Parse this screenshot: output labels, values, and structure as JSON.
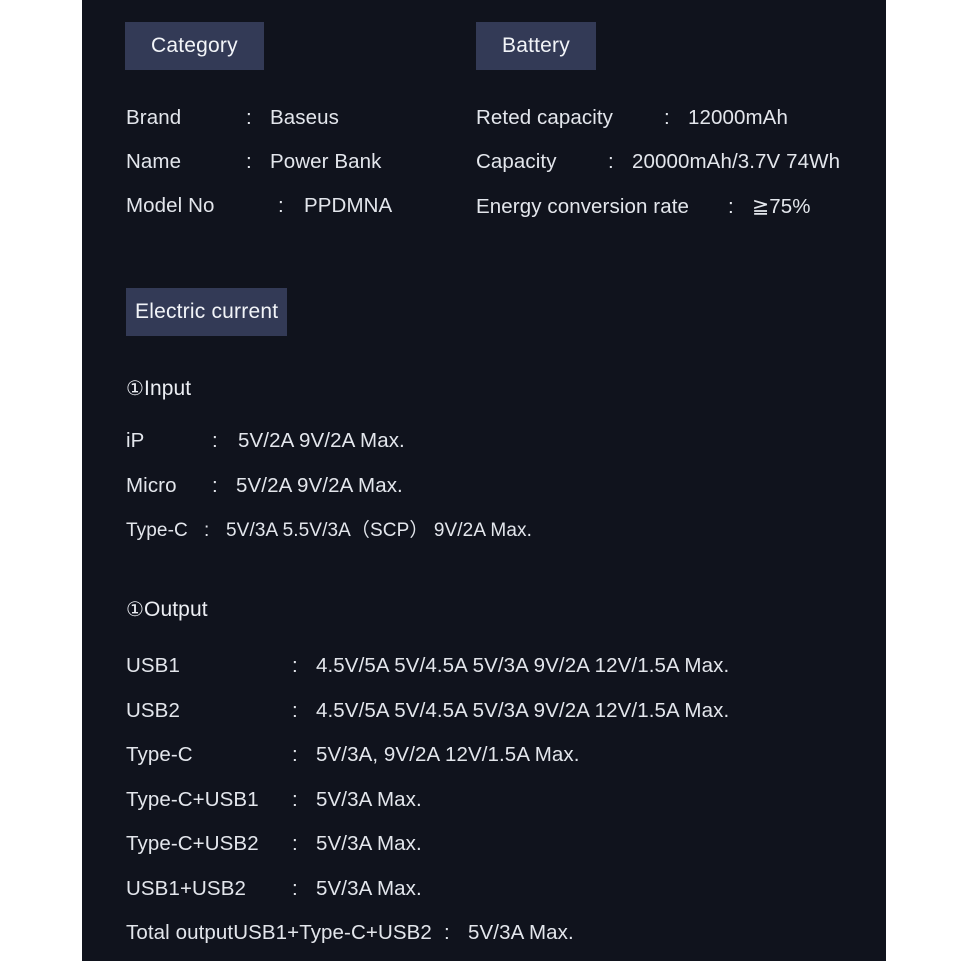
{
  "colors": {
    "page_background": "#ffffff",
    "panel_background": "#10131d",
    "badge_background": "#333a56",
    "text": "#e3e6ec"
  },
  "sections": {
    "category": {
      "badge": "Category",
      "rows": [
        {
          "label": "Brand",
          "separator": ":",
          "value": "Baseus"
        },
        {
          "label": "Name",
          "separator": ":",
          "value": "Power Bank"
        },
        {
          "label": "Model No",
          "separator": ":",
          "value": "PPDMNA"
        }
      ]
    },
    "battery": {
      "badge": "Battery",
      "rows": [
        {
          "label": "Reted capacity",
          "separator": ":",
          "value": "12000mAh"
        },
        {
          "label": "Capacity",
          "separator": ":",
          "value": "20000mAh/3.7V 74Wh"
        },
        {
          "label": "Energy conversion rate",
          "separator": ":",
          "value": "≧75%"
        }
      ]
    },
    "electric_current": {
      "badge": "Electric current",
      "input": {
        "heading_marker": "①",
        "heading": "Input",
        "rows": [
          {
            "label": "iP",
            "separator": ":",
            "value": "5V/2A  9V/2A  Max."
          },
          {
            "label": "Micro",
            "separator": ":",
            "value": "5V/2A   9V/2A  Max."
          },
          {
            "label": "Type-C",
            "separator": ":",
            "value": "5V/3A 5.5V/3A（SCP） 9V/2A Max."
          }
        ]
      },
      "output": {
        "heading_marker": "①",
        "heading": "Output",
        "rows": [
          {
            "label": "USB1",
            "separator": ":",
            "value": "4.5V/5A 5V/4.5A  5V/3A 9V/2A 12V/1.5A Max."
          },
          {
            "label": "USB2",
            "separator": ":",
            "value": "4.5V/5A 5V/4.5A  5V/3A 9V/2A 12V/1.5A Max."
          },
          {
            "label": "Type-C",
            "separator": ":",
            "value": "5V/3A, 9V/2A  12V/1.5A Max."
          },
          {
            "label": "Type-C+USB1",
            "separator": ":",
            "value": "5V/3A Max."
          },
          {
            "label": "Type-C+USB2",
            "separator": ":",
            "value": "5V/3A Max."
          },
          {
            "label": "USB1+USB2",
            "separator": ":",
            "value": "5V/3A Max."
          }
        ],
        "total_row": {
          "label": "Total outputUSB1+Type-C+USB2",
          "separator": ":",
          "value": "5V/3A Max."
        }
      }
    }
  }
}
